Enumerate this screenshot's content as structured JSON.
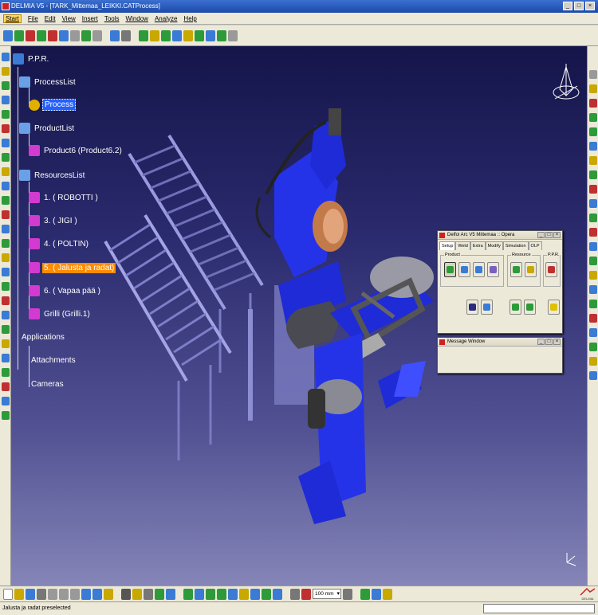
{
  "window": {
    "title": "DELMIA V5 - [TARK_Mittemaa_LEIKKI.CATProcess]",
    "min": "_",
    "max": "□",
    "close": "×"
  },
  "menu": {
    "items": [
      "Start",
      "File",
      "Edit",
      "View",
      "Insert",
      "Tools",
      "Window",
      "Analyze",
      "Help"
    ]
  },
  "tree": {
    "root": "P.P.R.",
    "process_list": "ProcessList",
    "process": "Process",
    "product_list": "ProductList",
    "product6": "Product6 (Product6.2)",
    "resource_list": "ResourcesList",
    "res1": "1. ( ROBOTTI )",
    "res3": "3. ( JIGI )",
    "res4": "4. ( POLTIN)",
    "res5": "5. ( Jalusta ja radat)",
    "res6": "6. ( Vapaa pää )",
    "grilli": "Grilli (Grilli.1)",
    "applications": "Applications",
    "attachments": "Attachments",
    "cameras": "Cameras"
  },
  "deneb_panel": {
    "title": "Delfoi Arc V5 Mittemaa :: Opera",
    "tabs": [
      "Setup",
      "Weld",
      "Extra",
      "Modify",
      "Simulation",
      "OLP"
    ],
    "group_product": "Product",
    "group_resource": "Resource",
    "group_ppr": "P.P.R."
  },
  "message_window": {
    "title": "Message Window"
  },
  "bottom_toolbar": {
    "units": "100 mm"
  },
  "status": {
    "text": "Jalusta ja radat  preselected"
  },
  "brand": {
    "logo": "DELMIA"
  },
  "colors": {
    "robot_blue": "#1f2bd6",
    "viewport_top": "#15154a",
    "viewport_bottom": "#8585b8",
    "selection": "#2360ff",
    "highlight": "#ff8c00"
  }
}
